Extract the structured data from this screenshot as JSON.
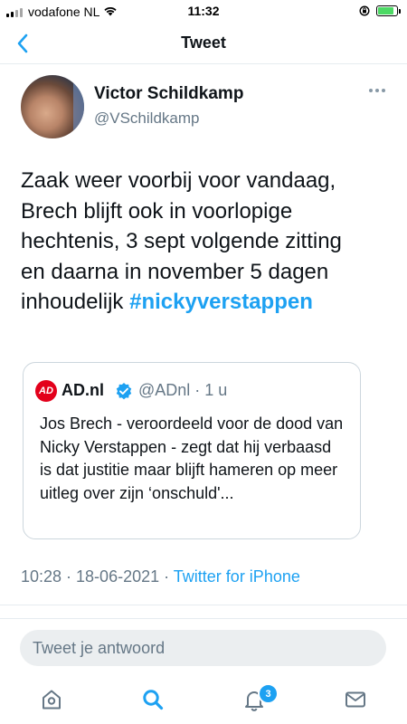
{
  "status_bar": {
    "carrier": "vodafone NL",
    "time": "11:32",
    "battery_level": 0.9
  },
  "nav": {
    "title": "Tweet",
    "back_icon": "chevron-left-icon"
  },
  "tweet": {
    "author_name": "Victor Schildkamp",
    "author_handle": "@VSchildkamp",
    "text_lines": [
      "Zaak weer voorbij voor vandaag,",
      "Brech blijft ook in voorlopige",
      "hechtenis, 3 sept volgende zitting",
      "en daarna in november 5 dagen",
      "inhoudelijk "
    ],
    "hashtag": "#nickyverstappen",
    "quoted": {
      "logo_text": "AD",
      "name": "AD.nl",
      "handle_time": "@ADnl · 1 u",
      "text": "Jos Brech - veroordeeld voor de dood van Nicky Verstappen - zegt dat hij verbaasd is dat justitie maar blijft hameren op meer uitleg over zijn ‘onschuld'..."
    },
    "timestamp": "10:28 · 18-06-2021 · ",
    "source": "Twitter for iPhone"
  },
  "reply": {
    "placeholder": "Tweet je antwoord"
  },
  "tabbar": {
    "items": [
      "home-icon",
      "search-icon",
      "notifications-icon",
      "messages-icon"
    ],
    "notification_count": "3"
  },
  "colors": {
    "accent": "#1da1f2",
    "secondary_text": "#657786",
    "brand_ad": "#e3001b"
  }
}
